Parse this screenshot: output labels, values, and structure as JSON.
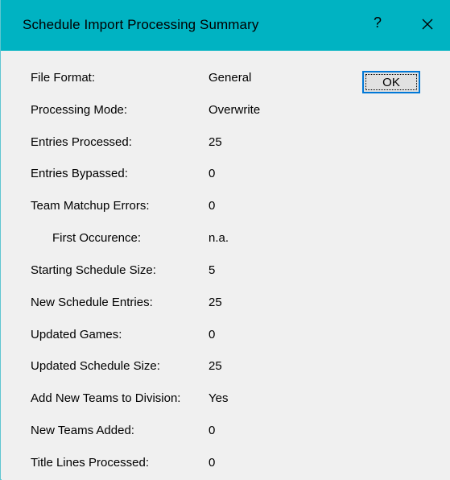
{
  "window": {
    "title": "Schedule Import Processing Summary",
    "help_glyph": "?",
    "close_icon": "close-icon",
    "titlebar_color": "#00b3c2"
  },
  "buttons": {
    "ok_label": "OK"
  },
  "rows": [
    {
      "label": "File Format:",
      "value": "General"
    },
    {
      "label": "Processing Mode:",
      "value": "Overwrite"
    },
    {
      "label": "Entries Processed:",
      "value": "25"
    },
    {
      "label": "Entries Bypassed:",
      "value": "0"
    },
    {
      "label": "Team Matchup Errors:",
      "value": "0"
    },
    {
      "label": "First Occurence:",
      "value": "n.a."
    },
    {
      "label": "Starting Schedule Size:",
      "value": "5"
    },
    {
      "label": "New Schedule Entries:",
      "value": "25"
    },
    {
      "label": "Updated Games:",
      "value": "0"
    },
    {
      "label": "Updated Schedule Size:",
      "value": "25"
    },
    {
      "label": "Add New Teams to Division:",
      "value": "Yes"
    },
    {
      "label": "New Teams Added:",
      "value": "0"
    },
    {
      "label": "Title Lines Processed:",
      "value": "0"
    }
  ]
}
